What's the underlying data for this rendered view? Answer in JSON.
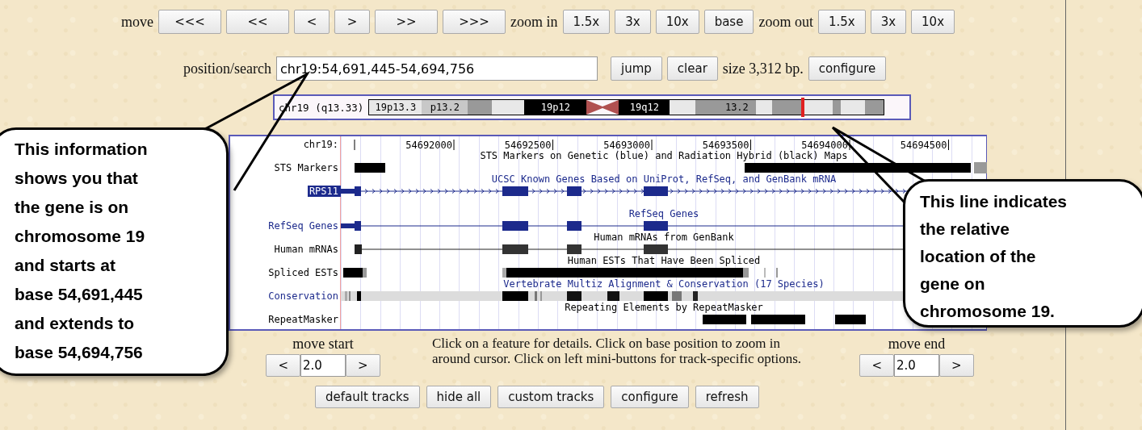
{
  "nav": {
    "move_label": "move",
    "move_buttons": [
      "<<<",
      "<<",
      "<",
      ">",
      ">>",
      ">>>"
    ],
    "zoom_in_label": "zoom in",
    "zoom_in_buttons": [
      "1.5x",
      "3x",
      "10x",
      "base"
    ],
    "zoom_out_label": "zoom out",
    "zoom_out_buttons": [
      "1.5x",
      "3x",
      "10x"
    ]
  },
  "search": {
    "label": "position/search",
    "value": "chr19:54,691,445-54,694,756",
    "buttons": [
      "jump",
      "clear"
    ],
    "size": "size 3,312 bp.",
    "configure": "configure"
  },
  "ideogram": {
    "label": "chr19 (q13.33)",
    "bands": [
      {
        "label": "19p13.3",
        "kind": "white"
      },
      {
        "label": "p13.2",
        "kind": "light"
      },
      {
        "kind": "gray"
      },
      {
        "kind": "white"
      },
      {
        "label": "19p12",
        "kind": "black"
      },
      {
        "kind": "centromere"
      },
      {
        "label": "19q12",
        "kind": "black"
      },
      {
        "kind": "white"
      },
      {
        "kind": "gray"
      },
      {
        "label": "13.2",
        "kind": "gray"
      },
      {
        "kind": "white"
      },
      {
        "kind": "gray"
      },
      {
        "kind": "white"
      },
      {
        "kind": "gray"
      },
      {
        "kind": "white"
      },
      {
        "kind": "gray"
      }
    ]
  },
  "ruler": {
    "label": "chr19:",
    "ticks": [
      "54692000",
      "54692500",
      "54693000",
      "54693500",
      "54694000",
      "54694500"
    ]
  },
  "tracks": [
    {
      "kind": "sts",
      "title": "STS Markers on Genetic (blue) and Radiation Hybrid (black) Maps",
      "label": "STS Markers",
      "link": false,
      "selected": false
    },
    {
      "kind": "known_gene",
      "title": "UCSC Known Genes Based on UniProt, RefSeq, and GenBank mRNA",
      "label": "RPS11",
      "link": true,
      "selected": true
    },
    {
      "kind": "refseq",
      "title": "RefSeq Genes",
      "label": "RefSeq Genes",
      "link": true,
      "selected": false
    },
    {
      "kind": "mrna",
      "title": "Human mRNAs from GenBank",
      "label": "Human mRNAs",
      "link": false,
      "selected": false
    },
    {
      "kind": "est",
      "title": "Human ESTs That Have Been Spliced",
      "label": "Spliced ESTs",
      "link": false,
      "selected": false
    },
    {
      "kind": "conservation",
      "title": "Vertebrate Multiz Alignment & Conservation (17 Species)",
      "label": "Conservation",
      "link": true,
      "selected": false
    },
    {
      "kind": "repeat",
      "title": "Repeating Elements by RepeatMasker",
      "label": "RepeatMasker",
      "link": false,
      "selected": false
    }
  ],
  "move_start": {
    "label": "move start",
    "left": "<",
    "value": "2.0",
    "right": ">"
  },
  "help_text": "Click on a feature for details. Click on base position to zoom in around cursor. Click on left mini-buttons for track-specific options.",
  "move_end": {
    "label": "move end",
    "left": "<",
    "value": "2.0",
    "right": ">"
  },
  "bottom_buttons": [
    "default tracks",
    "hide all",
    "custom tracks",
    "configure",
    "refresh"
  ],
  "callouts": [
    {
      "text": "This information\nshows you that\nthe gene is on\nchromosome 19\nand starts at\nbase 54,691,445\nand extends to\nbase 54,694,756"
    },
    {
      "text": "This line indicates\nthe relative\nlocation of the\ngene on\nchromosome 19."
    }
  ]
}
